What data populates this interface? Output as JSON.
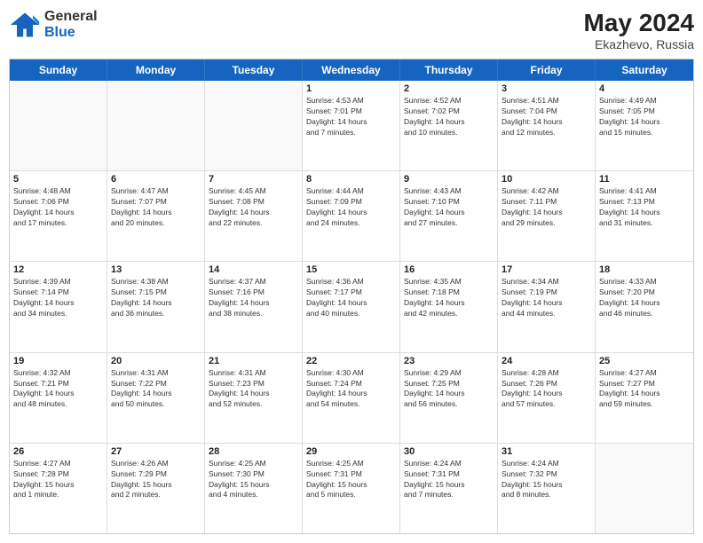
{
  "header": {
    "logo_general": "General",
    "logo_blue": "Blue",
    "main_title": "May 2024",
    "subtitle": "Ekazhevo, Russia"
  },
  "calendar": {
    "days_of_week": [
      "Sunday",
      "Monday",
      "Tuesday",
      "Wednesday",
      "Thursday",
      "Friday",
      "Saturday"
    ],
    "rows": [
      [
        {
          "day": "",
          "empty": true
        },
        {
          "day": "",
          "empty": true
        },
        {
          "day": "",
          "empty": true
        },
        {
          "day": "1",
          "lines": [
            "Sunrise: 4:53 AM",
            "Sunset: 7:01 PM",
            "Daylight: 14 hours",
            "and 7 minutes."
          ]
        },
        {
          "day": "2",
          "lines": [
            "Sunrise: 4:52 AM",
            "Sunset: 7:02 PM",
            "Daylight: 14 hours",
            "and 10 minutes."
          ]
        },
        {
          "day": "3",
          "lines": [
            "Sunrise: 4:51 AM",
            "Sunset: 7:04 PM",
            "Daylight: 14 hours",
            "and 12 minutes."
          ]
        },
        {
          "day": "4",
          "lines": [
            "Sunrise: 4:49 AM",
            "Sunset: 7:05 PM",
            "Daylight: 14 hours",
            "and 15 minutes."
          ]
        }
      ],
      [
        {
          "day": "5",
          "lines": [
            "Sunrise: 4:48 AM",
            "Sunset: 7:06 PM",
            "Daylight: 14 hours",
            "and 17 minutes."
          ]
        },
        {
          "day": "6",
          "lines": [
            "Sunrise: 4:47 AM",
            "Sunset: 7:07 PM",
            "Daylight: 14 hours",
            "and 20 minutes."
          ]
        },
        {
          "day": "7",
          "lines": [
            "Sunrise: 4:45 AM",
            "Sunset: 7:08 PM",
            "Daylight: 14 hours",
            "and 22 minutes."
          ]
        },
        {
          "day": "8",
          "lines": [
            "Sunrise: 4:44 AM",
            "Sunset: 7:09 PM",
            "Daylight: 14 hours",
            "and 24 minutes."
          ]
        },
        {
          "day": "9",
          "lines": [
            "Sunrise: 4:43 AM",
            "Sunset: 7:10 PM",
            "Daylight: 14 hours",
            "and 27 minutes."
          ]
        },
        {
          "day": "10",
          "lines": [
            "Sunrise: 4:42 AM",
            "Sunset: 7:11 PM",
            "Daylight: 14 hours",
            "and 29 minutes."
          ]
        },
        {
          "day": "11",
          "lines": [
            "Sunrise: 4:41 AM",
            "Sunset: 7:13 PM",
            "Daylight: 14 hours",
            "and 31 minutes."
          ]
        }
      ],
      [
        {
          "day": "12",
          "lines": [
            "Sunrise: 4:39 AM",
            "Sunset: 7:14 PM",
            "Daylight: 14 hours",
            "and 34 minutes."
          ]
        },
        {
          "day": "13",
          "lines": [
            "Sunrise: 4:38 AM",
            "Sunset: 7:15 PM",
            "Daylight: 14 hours",
            "and 36 minutes."
          ]
        },
        {
          "day": "14",
          "lines": [
            "Sunrise: 4:37 AM",
            "Sunset: 7:16 PM",
            "Daylight: 14 hours",
            "and 38 minutes."
          ]
        },
        {
          "day": "15",
          "lines": [
            "Sunrise: 4:36 AM",
            "Sunset: 7:17 PM",
            "Daylight: 14 hours",
            "and 40 minutes."
          ]
        },
        {
          "day": "16",
          "lines": [
            "Sunrise: 4:35 AM",
            "Sunset: 7:18 PM",
            "Daylight: 14 hours",
            "and 42 minutes."
          ]
        },
        {
          "day": "17",
          "lines": [
            "Sunrise: 4:34 AM",
            "Sunset: 7:19 PM",
            "Daylight: 14 hours",
            "and 44 minutes."
          ]
        },
        {
          "day": "18",
          "lines": [
            "Sunrise: 4:33 AM",
            "Sunset: 7:20 PM",
            "Daylight: 14 hours",
            "and 46 minutes."
          ]
        }
      ],
      [
        {
          "day": "19",
          "lines": [
            "Sunrise: 4:32 AM",
            "Sunset: 7:21 PM",
            "Daylight: 14 hours",
            "and 48 minutes."
          ]
        },
        {
          "day": "20",
          "lines": [
            "Sunrise: 4:31 AM",
            "Sunset: 7:22 PM",
            "Daylight: 14 hours",
            "and 50 minutes."
          ]
        },
        {
          "day": "21",
          "lines": [
            "Sunrise: 4:31 AM",
            "Sunset: 7:23 PM",
            "Daylight: 14 hours",
            "and 52 minutes."
          ]
        },
        {
          "day": "22",
          "lines": [
            "Sunrise: 4:30 AM",
            "Sunset: 7:24 PM",
            "Daylight: 14 hours",
            "and 54 minutes."
          ]
        },
        {
          "day": "23",
          "lines": [
            "Sunrise: 4:29 AM",
            "Sunset: 7:25 PM",
            "Daylight: 14 hours",
            "and 56 minutes."
          ]
        },
        {
          "day": "24",
          "lines": [
            "Sunrise: 4:28 AM",
            "Sunset: 7:26 PM",
            "Daylight: 14 hours",
            "and 57 minutes."
          ]
        },
        {
          "day": "25",
          "lines": [
            "Sunrise: 4:27 AM",
            "Sunset: 7:27 PM",
            "Daylight: 14 hours",
            "and 59 minutes."
          ]
        }
      ],
      [
        {
          "day": "26",
          "lines": [
            "Sunrise: 4:27 AM",
            "Sunset: 7:28 PM",
            "Daylight: 15 hours",
            "and 1 minute."
          ]
        },
        {
          "day": "27",
          "lines": [
            "Sunrise: 4:26 AM",
            "Sunset: 7:29 PM",
            "Daylight: 15 hours",
            "and 2 minutes."
          ]
        },
        {
          "day": "28",
          "lines": [
            "Sunrise: 4:25 AM",
            "Sunset: 7:30 PM",
            "Daylight: 15 hours",
            "and 4 minutes."
          ]
        },
        {
          "day": "29",
          "lines": [
            "Sunrise: 4:25 AM",
            "Sunset: 7:31 PM",
            "Daylight: 15 hours",
            "and 5 minutes."
          ]
        },
        {
          "day": "30",
          "lines": [
            "Sunrise: 4:24 AM",
            "Sunset: 7:31 PM",
            "Daylight: 15 hours",
            "and 7 minutes."
          ]
        },
        {
          "day": "31",
          "lines": [
            "Sunrise: 4:24 AM",
            "Sunset: 7:32 PM",
            "Daylight: 15 hours",
            "and 8 minutes."
          ]
        },
        {
          "day": "",
          "empty": true
        }
      ]
    ]
  }
}
